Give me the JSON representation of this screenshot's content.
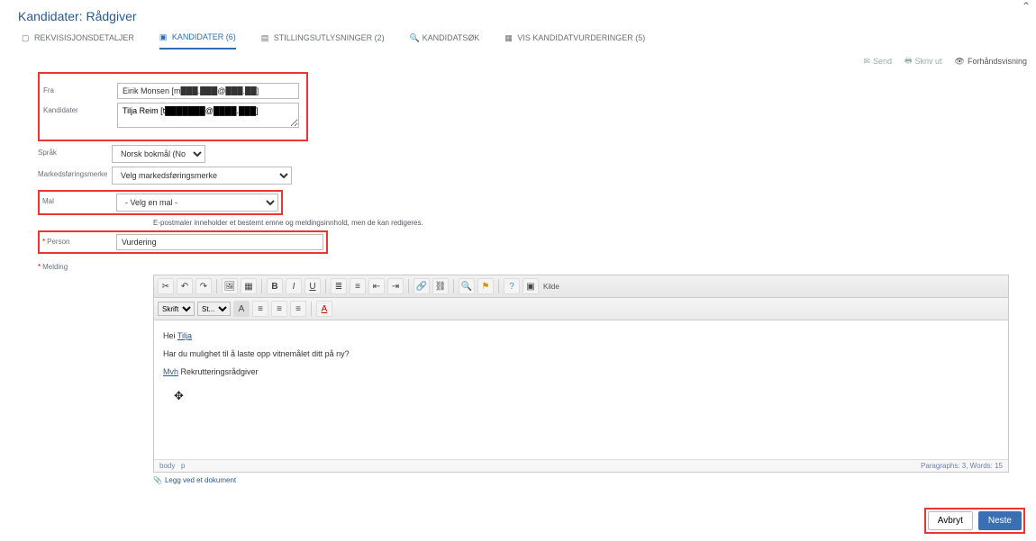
{
  "header": {
    "title": "Kandidater: Rådgiver"
  },
  "tabs": {
    "t0": "REKVISISJONSDETALJER",
    "t1": "KANDIDATER (6)",
    "t2": "STILLINGSUTLYSNINGER (2)",
    "t3": "KANDIDATSØK",
    "t4": "VIS KANDIDATVURDERINGER (5)"
  },
  "toolbar": {
    "send": "Send",
    "skriv_ut": "Skriv ut",
    "forhand": "Forhåndsvisning"
  },
  "labels": {
    "fra": "Fra",
    "kandidater": "Kandidater",
    "sprak": "Språk",
    "marked": "Markedsføringsmerke",
    "mal": "Mal",
    "person": "Person",
    "melding": "Melding"
  },
  "values": {
    "fra": "Eirik Monsen [m███.███@███.██]",
    "kandidater": "Tilja Reim [t███████@████.███]",
    "sprak": "Norsk bokmål (Norwegian Bokr",
    "marked": "Velg markedsføringsmerke",
    "mal": "- Velg en mal -",
    "person": "Vurdering"
  },
  "hint": "E-postmaler inneholder et bestemt emne og meldingsinnhold, men de kan redigeres.",
  "editor": {
    "font_sel": "Skrift",
    "size_sel": "St...",
    "source": "Kilde",
    "body_greeting_pre": "Hei ",
    "body_greeting_link": "Tilja",
    "body_line": "Har du mulighet til å laste opp vitnemålet ditt på ny?",
    "body_sig_link": "Mvh",
    "body_sig_rest": " Rekrutteringsrådgiver",
    "path": "body",
    "path_suffix": "p",
    "status": "Paragraphs: 3, Words: 15"
  },
  "attach": "Legg ved et dokument",
  "footer": {
    "cancel": "Avbryt",
    "next": "Neste"
  }
}
